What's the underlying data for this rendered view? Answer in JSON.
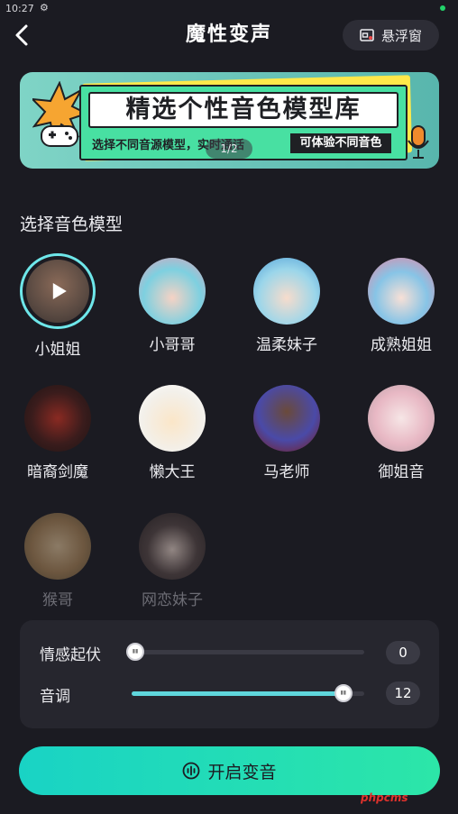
{
  "status_bar": {
    "time": "10:27",
    "gear_icon": "gear-icon"
  },
  "header": {
    "title": "魔性变声",
    "float_window_label": "悬浮窗"
  },
  "banner": {
    "title": "精选个性音色模型库",
    "subtitle": "选择不同音源模型，实时通话",
    "tag": "可体验不同音色",
    "page_indicator": "1/2"
  },
  "section_title": "选择音色模型",
  "voices": [
    {
      "label": "小姐姐",
      "selected": true,
      "enabled": true
    },
    {
      "label": "小哥哥",
      "selected": false,
      "enabled": true
    },
    {
      "label": "温柔妹子",
      "selected": false,
      "enabled": true
    },
    {
      "label": "成熟姐姐",
      "selected": false,
      "enabled": true
    },
    {
      "label": "暗裔剑魔",
      "selected": false,
      "enabled": true
    },
    {
      "label": "懒大王",
      "selected": false,
      "enabled": true
    },
    {
      "label": "马老师",
      "selected": false,
      "enabled": true
    },
    {
      "label": "御姐音",
      "selected": false,
      "enabled": true
    },
    {
      "label": "猴哥",
      "selected": false,
      "enabled": false
    },
    {
      "label": "网恋妹子",
      "selected": false,
      "enabled": false
    }
  ],
  "sliders": {
    "emotion": {
      "label": "情感起伏",
      "value": "0",
      "fraction": 0.0
    },
    "pitch": {
      "label": "音调",
      "value": "12",
      "fraction": 0.91
    }
  },
  "start_button_label": "开启变音",
  "watermark": "phpcms",
  "colors": {
    "accent": "#5fd6dc",
    "button_start": "#19d3c5",
    "button_end": "#2ce6a8",
    "background": "#1b1b22"
  }
}
